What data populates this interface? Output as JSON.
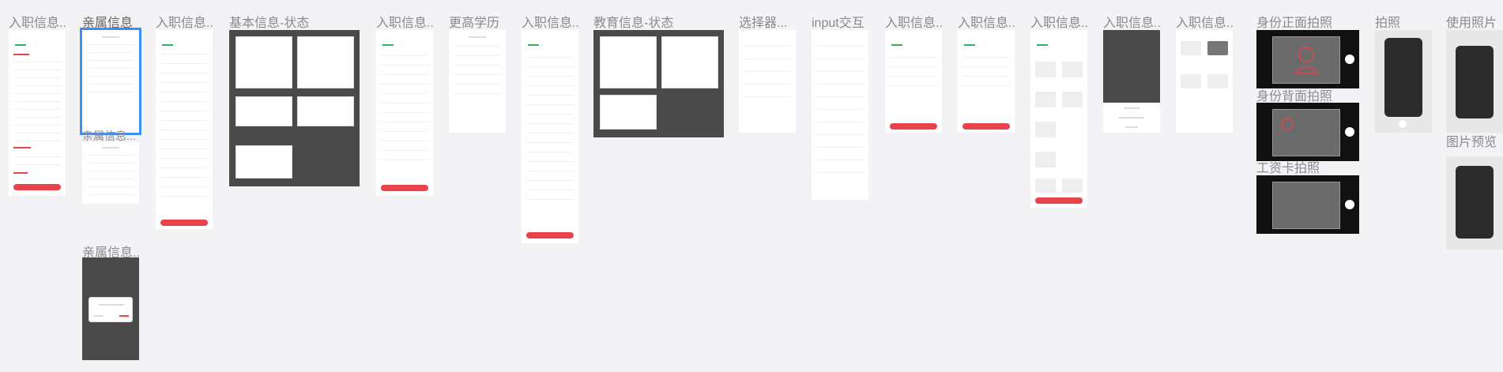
{
  "canvas": {
    "background": "#f3f3f5",
    "accent_red": "#e8434b",
    "selection_blue": "#3b8ff2"
  },
  "frame_titles": {
    "f1": "入职信息...",
    "f2": "亲属信息",
    "f2b": "亲属信息...",
    "f2c": "亲属信息...",
    "f3": "入职信息...",
    "f4": "基本信息-状态",
    "f5": "入职信息...",
    "f6": "更高学历",
    "f7": "入职信息...",
    "f8": "教育信息-状态",
    "f9": "选择器...",
    "f10": "input交互",
    "f11": "入职信息...",
    "f12": "入职信息...",
    "f13": "入职信息...",
    "f14": "入职信息...",
    "f15": "入职信息...",
    "f16": "身份正面拍照",
    "f16b": "身份背面拍照",
    "f16c": "工资卡拍照",
    "f17": "拍照",
    "f18": "使用照片",
    "f18b": "图片预览"
  },
  "icons": {
    "id_front": "person-outline-icon",
    "id_back": "emblem-outline-icon",
    "shutter": "shutter-button-icon"
  }
}
